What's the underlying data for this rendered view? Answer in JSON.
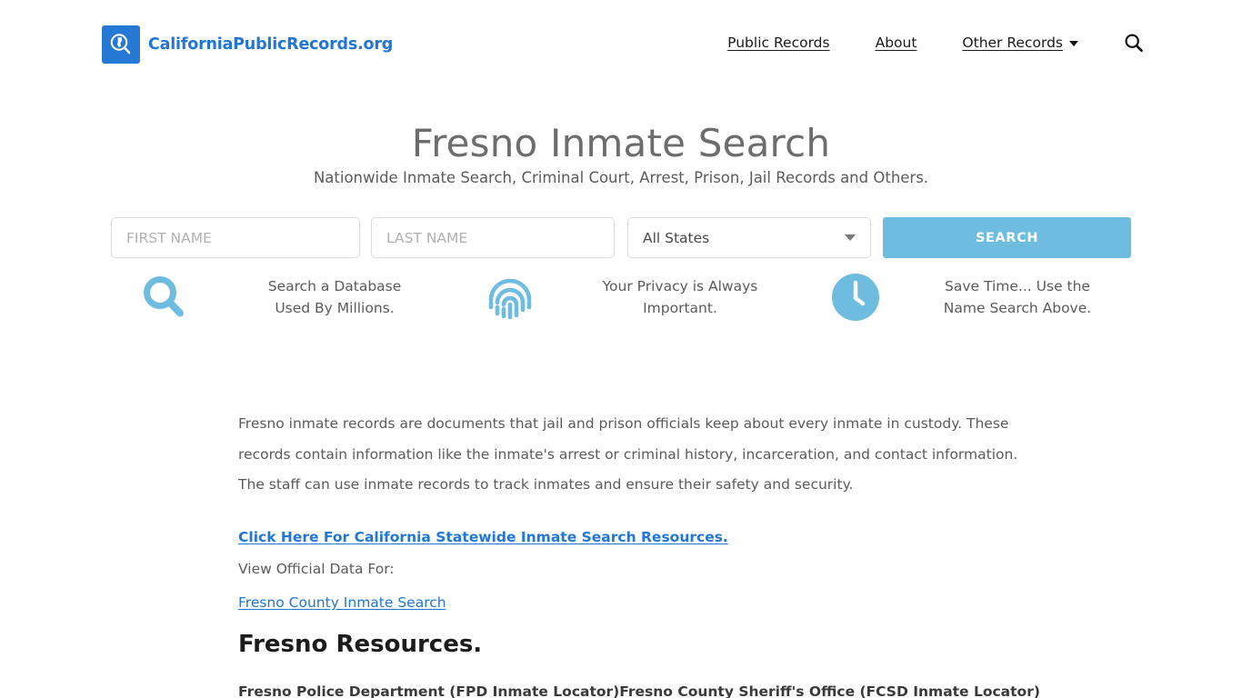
{
  "header": {
    "brand_name": "CaliforniaPublicRecords.org",
    "brand_icon": "magnifier-california-logo-icon",
    "nav": [
      {
        "label": "Public Records",
        "icon": null
      },
      {
        "label": "About",
        "icon": null
      },
      {
        "label": "Other Records",
        "icon": "chevron-down-icon"
      }
    ],
    "search_icon": "search-icon"
  },
  "hero": {
    "title": "Fresno Inmate Search",
    "subtitle": "Nationwide Inmate Search, Criminal Court, Arrest, Prison, Jail Records and Others."
  },
  "search_form": {
    "first_name_placeholder": "FIRST NAME",
    "first_name_value": "",
    "last_name_placeholder": "LAST NAME",
    "last_name_value": "",
    "state_selected": "All States",
    "state_caret_icon": "chevron-down-icon",
    "submit_label": "SEARCH",
    "submit_color": "#6ebce0"
  },
  "features": [
    {
      "icon": "magnifier-icon",
      "line1": "Search a Database",
      "line2": "Used By Millions."
    },
    {
      "icon": "fingerprint-icon",
      "line1": "Your Privacy is Always",
      "line2": "Important."
    },
    {
      "icon": "clock-icon",
      "line1": "Save Time... Use the",
      "line2": "Name Search Above."
    }
  ],
  "content": {
    "paragraph": "Fresno inmate records are documents that jail and prison officials keep about every inmate in custody. These records contain information like the inmate's arrest or criminal history, incarceration, and contact information. The staff can use inmate records to track inmates and ensure their safety and security.",
    "statewide_link": "Click Here For California Statewide Inmate Search Resources.",
    "view_official_label": "View Official Data For:",
    "county_link": "Fresno County Inmate Search",
    "resources_heading": "Fresno Resources.",
    "resource_columns": [
      "Fresno Police Department (FPD Inmate Locator)",
      "Fresno County Sheriff's Office (FCSD Inmate Locator)"
    ]
  },
  "colors": {
    "brand_blue": "#2176d6",
    "accent_blue": "#6ebce0",
    "link_blue": "#2176d6",
    "body_text": "#5b5b5b",
    "title_gray": "#6d6d6d"
  }
}
